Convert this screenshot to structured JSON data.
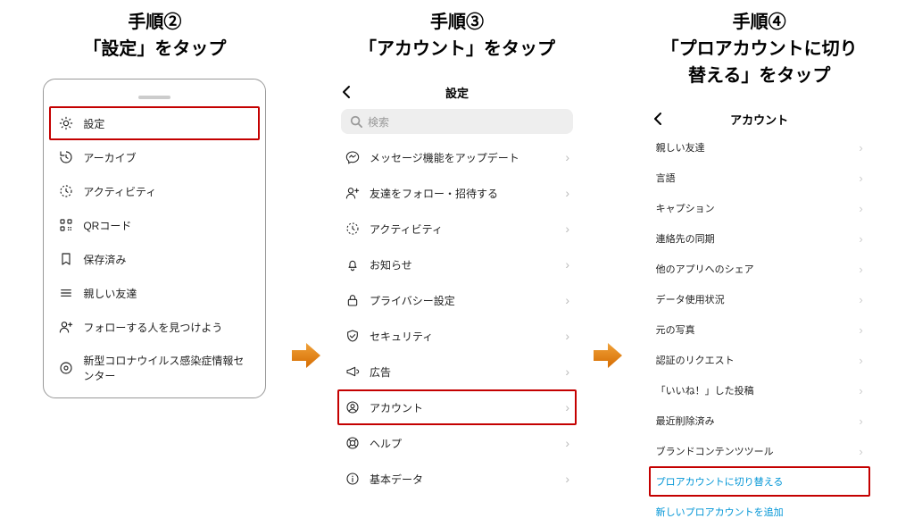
{
  "steps": {
    "s2": {
      "title": "手順②\n「設定」をタップ"
    },
    "s3": {
      "title": "手順③\n「アカウント」をタップ"
    },
    "s4": {
      "title": "手順④\n「プロアカウントに切り\n替える」をタップ"
    }
  },
  "panel2": {
    "items": [
      {
        "label": "設定",
        "highlight": true
      },
      {
        "label": "アーカイブ"
      },
      {
        "label": "アクティビティ"
      },
      {
        "label": "QRコード"
      },
      {
        "label": "保存済み"
      },
      {
        "label": "親しい友達"
      },
      {
        "label": "フォローする人を見つけよう"
      },
      {
        "label": "新型コロナウイルス感染症情報センター"
      }
    ]
  },
  "panel3": {
    "header": "設定",
    "search_placeholder": "検索",
    "items": [
      {
        "label": "メッセージ機能をアップデート"
      },
      {
        "label": "友達をフォロー・招待する"
      },
      {
        "label": "アクティビティ"
      },
      {
        "label": "お知らせ"
      },
      {
        "label": "プライバシー設定"
      },
      {
        "label": "セキュリティ"
      },
      {
        "label": "広告"
      },
      {
        "label": "アカウント",
        "highlight": true
      },
      {
        "label": "ヘルプ"
      },
      {
        "label": "基本データ"
      }
    ]
  },
  "panel4": {
    "header": "アカウント",
    "items": [
      {
        "label": "親しい友達"
      },
      {
        "label": "言語"
      },
      {
        "label": "キャプション"
      },
      {
        "label": "連絡先の同期"
      },
      {
        "label": "他のアプリへのシェア"
      },
      {
        "label": "データ使用状況"
      },
      {
        "label": "元の写真"
      },
      {
        "label": "認証のリクエスト"
      },
      {
        "label": "「いいね！」した投稿"
      },
      {
        "label": "最近削除済み"
      },
      {
        "label": "ブランドコンテンツツール"
      },
      {
        "label": "プロアカウントに切り替える",
        "highlight": true,
        "link": true
      },
      {
        "label": "新しいプロアカウントを追加",
        "link": true
      }
    ]
  }
}
